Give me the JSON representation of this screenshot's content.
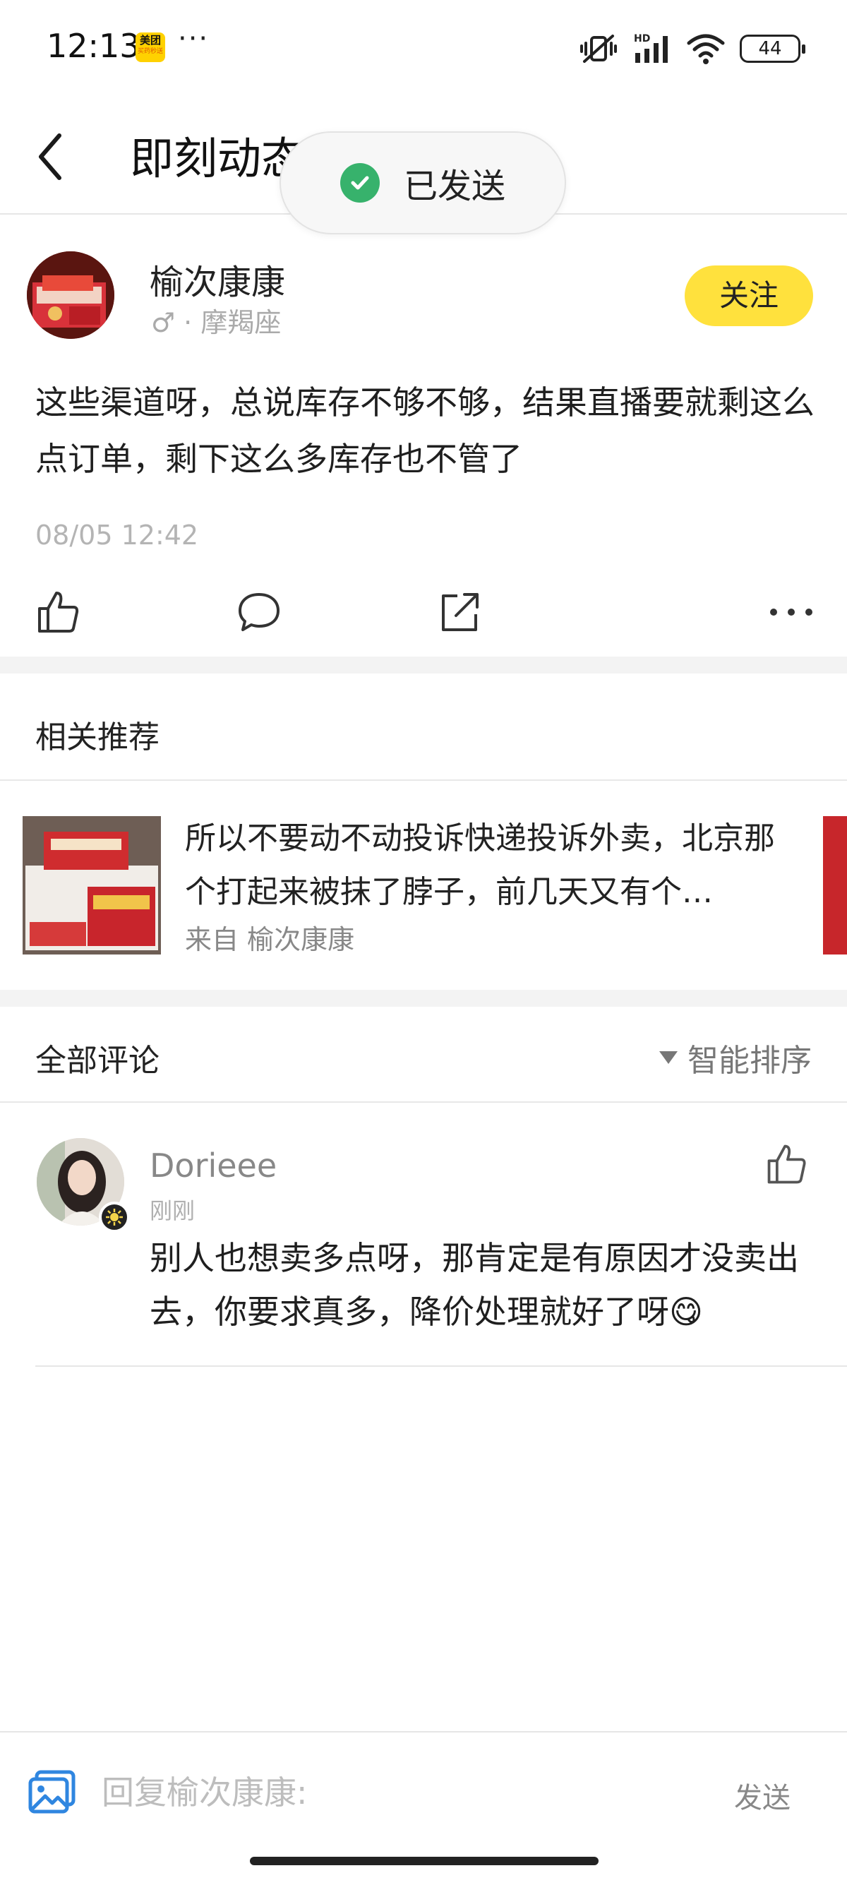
{
  "status_bar": {
    "time": "12:13",
    "app_badge_top": "美团",
    "app_badge_bottom": "买药秒送",
    "more": "···",
    "battery": "44"
  },
  "header": {
    "title": "即刻动态",
    "back_icon": "chevron-left-icon"
  },
  "toast": {
    "text": "已发送",
    "icon": "check-circle-icon",
    "color": "#37b26c"
  },
  "post": {
    "author_name": "榆次康康",
    "gender_symbol": "♂",
    "author_meta": "· 摩羯座",
    "follow_label": "关注",
    "text": "这些渠道呀，总说库存不够不够，结果直播要就剩这么点订单，剩下这么多库存也不管了",
    "time": "08/05 12:42"
  },
  "actions": {
    "like_icon": "thumbs-up-icon",
    "comment_icon": "comment-icon",
    "share_icon": "share-icon",
    "more_icon": "more-horizontal-icon"
  },
  "related": {
    "title": "相关推荐",
    "item_text": "所以不要动不动投诉快递投诉外卖，北京那个打起来被抹了脖子，前几天又有个…",
    "item_from": "来自 榆次康康"
  },
  "comments": {
    "title": "全部评论",
    "sort_label": "智能排序",
    "items": [
      {
        "name": "Dorieee",
        "time": "刚刚",
        "text": "别人也想卖多点呀，那肯定是有原因才没卖出去，你要求真多，降价处理就好了呀😋"
      }
    ]
  },
  "reply_bar": {
    "placeholder": "回复榆次康康:",
    "send_label": "发送"
  },
  "colors": {
    "accent_yellow": "#ffe13d",
    "image_icon_blue": "#2f86e0"
  }
}
